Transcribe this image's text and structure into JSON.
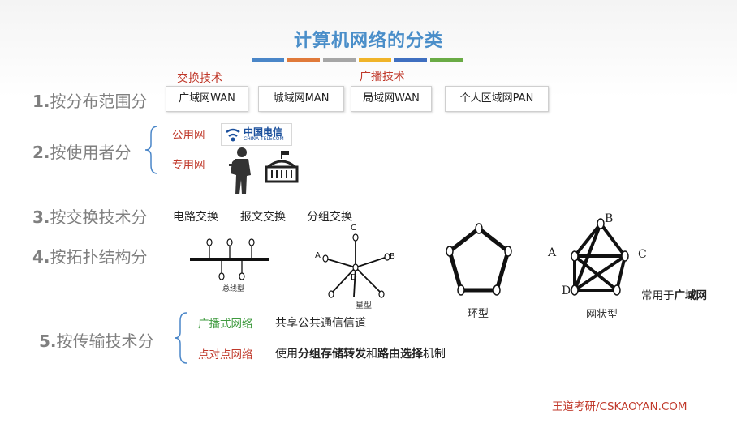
{
  "title": "计算机网络的分类",
  "accent_bars": [
    "#4a86c8",
    "#e07a3a",
    "#a6a6a6",
    "#f0b429",
    "#3f6fc0",
    "#6aab45"
  ],
  "rows": {
    "scope": {
      "num": "1.",
      "label": "按分布范围分",
      "annot_switch": "交换技术",
      "annot_broadcast": "广播技术",
      "items": [
        "广域网WAN",
        "城域网MAN",
        "局域网WAN",
        "个人区域网PAN"
      ]
    },
    "user": {
      "num": "2.",
      "label": "按使用者分",
      "public": "公用网",
      "private": "专用网",
      "telecom_cn": "中国电信",
      "telecom_en": "CHINA TELECOM"
    },
    "switching": {
      "num": "3.",
      "label": "按交换技术分",
      "items": [
        "电路交换",
        "报文交换",
        "分组交换"
      ]
    },
    "topology": {
      "num": "4.",
      "label": "按拓扑结构分",
      "bus": "总线型",
      "star": "星型",
      "ring": "环型",
      "mesh": "网状型",
      "star_nodes": [
        "A",
        "B",
        "C",
        "D"
      ],
      "mesh_nodes": [
        "A",
        "B",
        "C",
        "D"
      ],
      "note_prefix": "常用于",
      "note_bold": "广域网"
    },
    "transmission": {
      "num": "5.",
      "label": "按传输技术分",
      "broadcast_label": "广播式网络",
      "broadcast_desc": "共享公共通信信道",
      "p2p_label": "点对点网络",
      "p2p_desc_1": "使用",
      "p2p_desc_bold1": "分组存储转发",
      "p2p_desc_2": "和",
      "p2p_desc_bold2": "路由选择",
      "p2p_desc_3": "机制"
    }
  },
  "footer": "王道考研/CSKAOYAN.COM"
}
